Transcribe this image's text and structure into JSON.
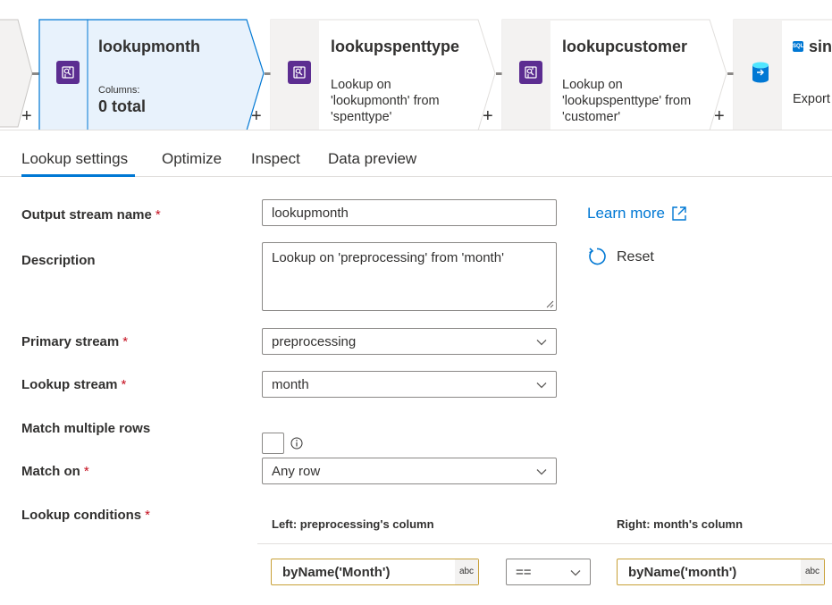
{
  "pipeline": {
    "nodes": [
      {
        "id": "lookupmonth",
        "title": "lookupmonth",
        "columns_label": "Columns:",
        "columns_value": "0 total",
        "icon": "lookup-icon"
      },
      {
        "id": "lookupspenttype",
        "title": "lookupspenttype",
        "description": "Lookup on\n'lookupmonth' from\n'spenttype'",
        "icon": "lookup-icon"
      },
      {
        "id": "lookupcustomer",
        "title": "lookupcustomer",
        "description": "Lookup on\n'lookupspenttype' from\n'customer'",
        "icon": "lookup-icon"
      },
      {
        "id": "sink",
        "title": "sinl",
        "description": "Export",
        "icon": "sink-database-icon",
        "tag": "SQL"
      }
    ],
    "add_symbol": "+"
  },
  "tabs": [
    {
      "label": "Lookup settings",
      "active": true
    },
    {
      "label": "Optimize",
      "active": false
    },
    {
      "label": "Inspect",
      "active": false
    },
    {
      "label": "Data preview",
      "active": false
    }
  ],
  "form": {
    "output_stream_name": {
      "label": "Output stream name",
      "required": "*",
      "value": "lookupmonth"
    },
    "description": {
      "label": "Description",
      "value": "Lookup on 'preprocessing' from 'month'"
    },
    "primary_stream": {
      "label": "Primary stream",
      "required": "*",
      "value": "preprocessing"
    },
    "lookup_stream": {
      "label": "Lookup stream",
      "required": "*",
      "value": "month"
    },
    "match_multiple_rows": {
      "label": "Match multiple rows",
      "checked": false
    },
    "match_on": {
      "label": "Match on",
      "required": "*",
      "value": "Any row"
    },
    "lookup_conditions": {
      "label": "Lookup conditions",
      "required": "*",
      "left_header": "Left: preprocessing's column",
      "right_header": "Right: month's column",
      "left_expr": "byName('Month')",
      "operator": "==",
      "right_expr": "byName('month')",
      "type_badge": "abc"
    }
  },
  "actions": {
    "learn_more": "Learn more",
    "reset": "Reset"
  },
  "colors": {
    "accent": "#0078d4",
    "lookup_icon": "#5c2d91",
    "required": "#c50f1f",
    "expression_border": "#c8a037",
    "selected_node_fill": "#e8f2fc"
  }
}
